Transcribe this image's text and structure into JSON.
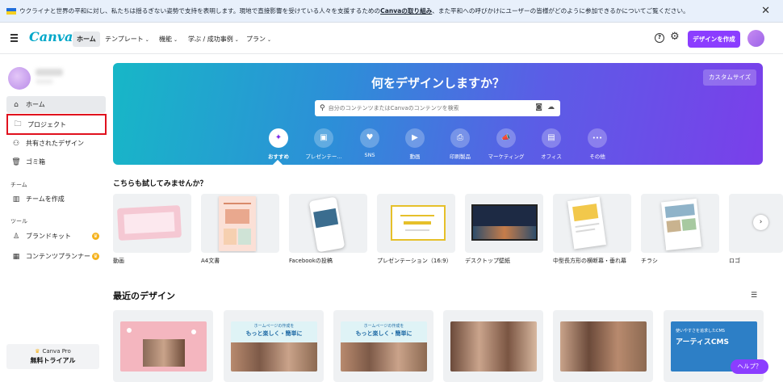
{
  "banner": {
    "text_before": "ウクライナと世界の平和に対し、私たちは揺るぎない姿勢で支持を表明します。現地で直接影響を受けている人々を支援するための",
    "link": "Canvaの取り組み",
    "text_after": "、また平和への呼びかけにユーザーの皆様がどのように参加できるかについてご覧ください。",
    "close": "✕"
  },
  "nav": {
    "logo": "Canva",
    "home": "ホーム",
    "templates": "テンプレート",
    "features": "機能",
    "learn": "学ぶ / 成功事例",
    "plans": "プラン",
    "help_icon": "?",
    "gear_icon": "⚙",
    "create_button": "デザインを作成"
  },
  "sidebar": {
    "home": "ホーム",
    "projects": "プロジェクト",
    "shared": "共有されたデザイン",
    "trash": "ゴミ箱",
    "team_section": "チーム",
    "create_team": "チームを作成",
    "tools_section": "ツール",
    "brand_kit": "ブランドキット",
    "content_planner": "コンテンツプランナー",
    "pro_label": "Canva Pro",
    "pro_trial": "無料トライアル"
  },
  "hero": {
    "title": "何をデザインしますか？",
    "custom_size": "カスタムサイズ",
    "search_placeholder": "自分のコンテンツまたはCanvaのコンテンツを検索",
    "categories": [
      {
        "label": "おすすめ",
        "icon": "sparkle-icon",
        "glyph": "✦"
      },
      {
        "label": "プレゼンテー...",
        "icon": "presentation-icon",
        "glyph": "▣"
      },
      {
        "label": "SNS",
        "icon": "heart-icon",
        "glyph": "♥"
      },
      {
        "label": "動画",
        "icon": "video-icon",
        "glyph": "▶"
      },
      {
        "label": "印刷製品",
        "icon": "printer-icon",
        "glyph": "⎙"
      },
      {
        "label": "マーケティング",
        "icon": "megaphone-icon",
        "glyph": "📣"
      },
      {
        "label": "オフィス",
        "icon": "briefcase-icon",
        "glyph": "▤"
      },
      {
        "label": "その他",
        "icon": "more-icon",
        "glyph": "•••"
      }
    ]
  },
  "try_section": {
    "title": "こちらも試してみませんか？",
    "items": [
      {
        "label": "動画"
      },
      {
        "label": "A4文書"
      },
      {
        "label": "Facebookの投稿"
      },
      {
        "label": "プレゼンテーション（16:9）"
      },
      {
        "label": "デスクトップ壁紙"
      },
      {
        "label": "中型長方形の横断幕・垂れ幕"
      },
      {
        "label": "チラシ"
      },
      {
        "label": "ロゴ"
      }
    ]
  },
  "recent": {
    "title": "最近のデザイン",
    "card_texts": {
      "c2_top": "ホームページの作成を",
      "c2_big": "もっと楽しく・簡単に",
      "c3_top": "ホームページの作成を",
      "c3_big": "もっと楽しく・簡単に",
      "c6_top": "使いやすさを追求したCMS",
      "c6_big": "アーティスCMS"
    }
  },
  "help_button": "ヘルプ？",
  "colors": {
    "accent": "#8b3dff",
    "highlight_border": "#e0111e",
    "hero_start": "#17b7c7",
    "hero_end": "#7a3fea"
  }
}
